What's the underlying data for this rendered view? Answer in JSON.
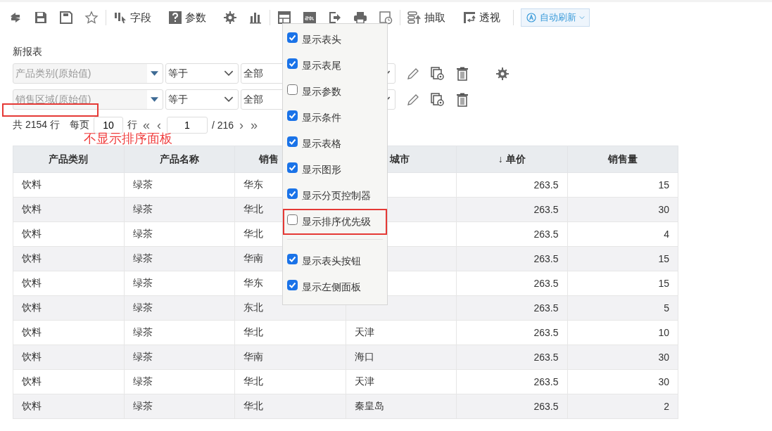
{
  "toolbar": {
    "field_label": "字段",
    "param_label": "参数",
    "extract_label": "抽取",
    "pivot_label": "透视",
    "auto_refresh": "自动刷新"
  },
  "report_title": "新报表",
  "filters": [
    {
      "field": "产品类别(原始值)",
      "operator": "等于",
      "value": "全部"
    },
    {
      "field": "销售区域(原始值)",
      "operator": "等于",
      "value": "全部"
    }
  ],
  "pager": {
    "total": "共 2154 行",
    "per_page_label": "每页",
    "per_page": "10",
    "rows_unit": "行",
    "first": "«",
    "prev": "‹",
    "page": "1",
    "pages": "/ 216",
    "next": "›",
    "last": "»"
  },
  "annotation": "不显示排序面板",
  "table": {
    "columns": [
      {
        "label": "产品类别"
      },
      {
        "label": "产品名称"
      },
      {
        "label": "销售"
      },
      {
        "label": "城市"
      },
      {
        "label": "单价",
        "sort_icon": "↓"
      },
      {
        "label": "销售量"
      }
    ],
    "rows": [
      {
        "category": "饮料",
        "name": "绿茶",
        "region": "华东",
        "price": "263.5",
        "qty": "15"
      },
      {
        "category": "饮料",
        "name": "绿茶",
        "region": "华北",
        "price": "263.5",
        "qty": "30"
      },
      {
        "category": "饮料",
        "name": "绿茶",
        "region": "华北",
        "price": "263.5",
        "qty": "4"
      },
      {
        "category": "饮料",
        "name": "绿茶",
        "region": "华南",
        "price": "263.5",
        "qty": "15"
      },
      {
        "category": "饮料",
        "name": "绿茶",
        "region": "华东",
        "price": "263.5",
        "qty": "15"
      },
      {
        "category": "饮料",
        "name": "绿茶",
        "region": "东北",
        "price": "263.5",
        "qty": "5"
      },
      {
        "category": "饮料",
        "name": "绿茶",
        "region": "华北",
        "city": "天津",
        "price": "263.5",
        "qty": "10"
      },
      {
        "category": "饮料",
        "name": "绿茶",
        "region": "华南",
        "city": "海口",
        "price": "263.5",
        "qty": "30"
      },
      {
        "category": "饮料",
        "name": "绿茶",
        "region": "华北",
        "city": "天津",
        "price": "263.5",
        "qty": "30"
      },
      {
        "category": "饮料",
        "name": "绿茶",
        "region": "华北",
        "city": "秦皇岛",
        "price": "263.5",
        "qty": "2"
      }
    ]
  },
  "menu": {
    "items": [
      {
        "label": "显示表头",
        "checked": true
      },
      {
        "label": "显示表尾",
        "checked": true
      },
      {
        "label": "显示参数",
        "checked": false
      },
      {
        "label": "显示条件",
        "checked": true
      },
      {
        "label": "显示表格",
        "checked": true
      },
      {
        "label": "显示图形",
        "checked": true
      },
      {
        "label": "显示分页控制器",
        "checked": true
      },
      {
        "label": "显示排序优先级",
        "checked": false,
        "highlighted": true
      },
      {
        "label": "显示表头按钮",
        "checked": true,
        "separated": true
      },
      {
        "label": "显示左侧面板",
        "checked": true
      }
    ]
  }
}
